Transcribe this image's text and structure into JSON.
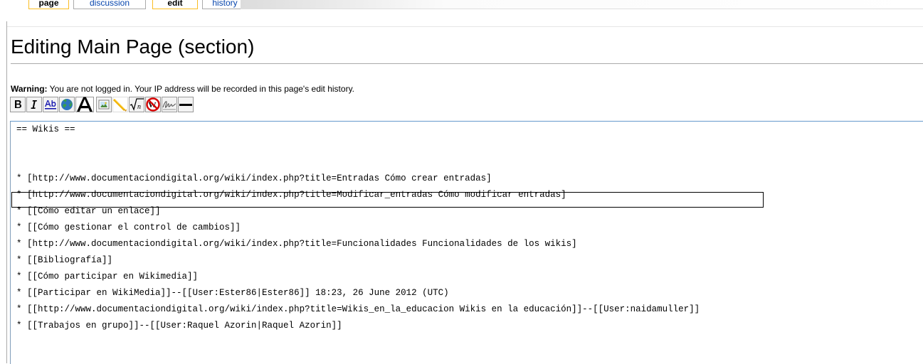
{
  "tabs": [
    {
      "label": "page",
      "selected": true
    },
    {
      "label": "discussion",
      "selected": false
    },
    {
      "label": "edit",
      "selected": true
    },
    {
      "label": "history",
      "selected": false
    }
  ],
  "page_title": "Editing Main Page (section)",
  "warning": {
    "label": "Warning:",
    "text": " You are not logged in. Your IP address will be recorded in this page's edit history."
  },
  "toolbar": [
    {
      "name": "bold-button",
      "icon": "bold-icon"
    },
    {
      "name": "italic-button",
      "icon": "italic-icon"
    },
    {
      "name": "internal-link-button",
      "icon": "link-icon"
    },
    {
      "name": "external-link-button",
      "icon": "globe-icon"
    },
    {
      "name": "headline-button",
      "icon": "headline-icon"
    },
    {
      "name": "embedded-image-button",
      "icon": "image-icon"
    },
    {
      "name": "media-link-button",
      "icon": "media-icon"
    },
    {
      "name": "math-formula-button",
      "icon": "math-icon"
    },
    {
      "name": "nowiki-button",
      "icon": "nowiki-icon"
    },
    {
      "name": "signature-button",
      "icon": "signature-icon"
    },
    {
      "name": "horizontal-line-button",
      "icon": "hr-icon"
    }
  ],
  "editor": {
    "lines": [
      "== Wikis ==",
      "",
      "",
      "* [http://www.documentaciondigital.org/wiki/index.php?title=Entradas Cómo crear entradas]",
      "* [http://www.documentaciondigital.org/wiki/index.php?title=Modificar_entradas Cómo modificar entradas]",
      "* [[Cómo editar un enlace]]",
      "* [[Cómo gestionar el control de cambios]]",
      "* [http://www.documentaciondigital.org/wiki/index.php?title=Funcionalidades Funcionalidades de los wikis]",
      "* [[Bibliografía]]",
      "* [[Cómo participar en Wikimedia]]",
      "* [[Participar en WikiMedia]]--[[User:Ester86|Ester86]] 18:23, 26 June 2012 (UTC)",
      "* [[http://www.documentaciondigital.org/wiki/index.php?title=Wikis_en_la_educacion Wikis en la educación]]--[[User:naidamuller]]",
      "* [[Trabajos en grupo]]--[[User:Raquel Azorin|Raquel Azorin]]"
    ]
  },
  "colors": {
    "tab_selected_border": "#fabd23",
    "link": "#0645ad",
    "rule": "#aaaaaa",
    "editor_border": "#6699cc"
  }
}
